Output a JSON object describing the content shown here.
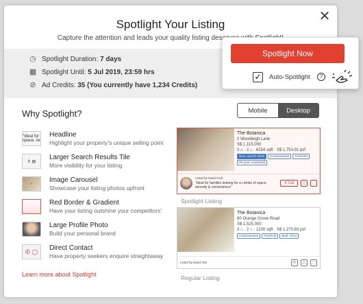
{
  "modal": {
    "title": "Spotlight Your Listing",
    "subtitle": "Capture the attention and leads your quality listing deserves with Spotlight!",
    "close_icon": "close-icon"
  },
  "details": {
    "duration_label": "Spotlight Duration:",
    "duration_value": "7 days",
    "until_label": "Spotlight Until:",
    "until_value": "5 Jul 2019, 23:59 hrs",
    "credits_label": "Ad Credits:",
    "credits_value": "35 (You currently have 1,234 Credits)"
  },
  "cta": {
    "button": "Spotlight Now",
    "auto_label": "Auto-Spotlight",
    "help": "?",
    "checked": "✓"
  },
  "why": {
    "title": "Why Spotlight?"
  },
  "toggle": {
    "mobile": "Mobile",
    "desktop": "Desktop"
  },
  "features": [
    {
      "title": "Headline",
      "desc": "Highlight your property's unique selling point",
      "thumb": "\"Ideal for space, se"
    },
    {
      "title": "Larger Search Results Tile",
      "desc": "More visibility for your listing"
    },
    {
      "title": "Image Carousel",
      "desc": "Showcase your listing photos upfront"
    },
    {
      "title": "Red Border & Gradient",
      "desc": "Have your listing outshine your competitors'"
    },
    {
      "title": "Large Profile Photo",
      "desc": "Build your personal brand"
    },
    {
      "title": "Direct Contact",
      "desc": "Have property seekers enquire straightaway"
    }
  ],
  "learn_more": "Learn more about Spotlight",
  "spot_card": {
    "name": "The Botanica",
    "address": "2 Woodleigh Lane",
    "price": "S$ 1,115,000",
    "specs": "3 ⌂ · 2 ⌂ · 6254 sqft · S$ 1,753.91 psf",
    "tags": [
      "New Launch 2020",
      "Condominium",
      "Freehold"
    ],
    "tag2": "99-year Leasehold",
    "listed_by": "Listed by David Goh",
    "quote": "\"Ideal for families looking for a combo of space, serenity & convenience\"",
    "call": "Call",
    "label": "Spotlight Listing"
  },
  "reg_card": {
    "name": "The Botanica",
    "address": "60 Orange Grove Road",
    "price": "S$ 1,525,000",
    "specs": "3 ⌂ · 2 ⌂ · 1200 sqft · S$ 1,270.83 psf",
    "tags": [
      "Condominium",
      "Freehold",
      "Built: 2014"
    ],
    "listed_by": "Listed by David Tan",
    "label": "Regular Listing"
  }
}
